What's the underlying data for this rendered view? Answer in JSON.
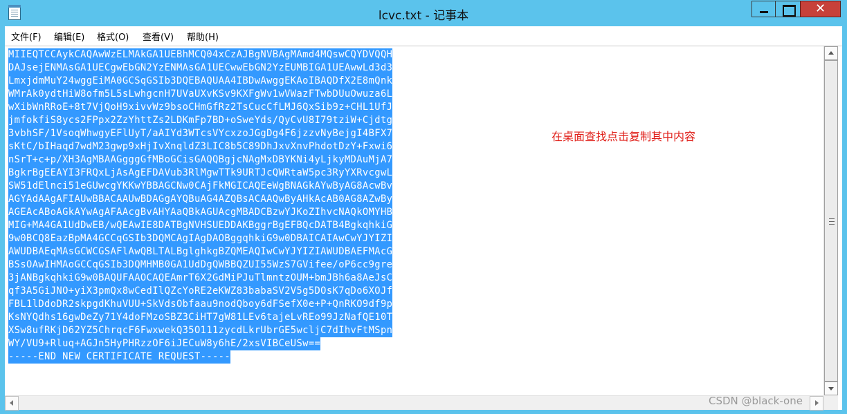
{
  "window": {
    "title": "lcvc.txt - 记事本",
    "close_glyph": "✕",
    "icons": {
      "app": "notepad-icon",
      "minimize": "minimize-icon",
      "maximize": "maximize-icon",
      "close": "close-icon"
    },
    "colors": {
      "titlebar": "#5bc3ec",
      "close_button": "#c7413a",
      "selection": "#3399ff",
      "annotation": "#e0201a"
    }
  },
  "menu": {
    "items": [
      {
        "label": "文件(F)"
      },
      {
        "label": "编辑(E)"
      },
      {
        "label": "格式(O)"
      },
      {
        "label": "查看(V)"
      },
      {
        "label": "帮助(H)"
      }
    ]
  },
  "editor": {
    "selected": true,
    "lines": [
      "MIIEQTCCAykCAQAwWzELMAkGA1UEBhMCQ04xCzAJBgNVBAgMAmd4MQswCQYDVQQH",
      "DAJsejENMAsGA1UECgwEbGN2YzENMAsGA1UECwwEbGN2YzEUMBIGA1UEAwwLd3d3",
      "LmxjdmMuY24wggEiMA0GCSqGSIb3DQEBAQUAA4IBDwAwggEKAoIBAQDfX2E8mQnk",
      "WMrAk0ydtHiW8ofm5L5sLwhgcnH7UVaUXvKSv9KXFgWv1wVWazFTwbDUuOwuza6L",
      "wXibWnRRoE+8t7VjQoH9xivvWz9bsoCHmGfRz2TsCucCfLMJ6QxSib9z+CHL1UfJ",
      "jmfokfiS8ycs2FPpx2ZzYhttZs2LDKmFp7BD+oSweYds/QyCvU8I79tziW+Cjdtg",
      "3vbhSF/1VsoqWhwgyEFlUyT/aAIYd3WTcsVYcxzoJGgDg4F6jzzvNyBejgI4BFX7",
      "sKtC/bIHaqd7wdM23gwp9xHjIvXnqldZ3LIC8b5C89DhJxvXnvPhdotDzY+Fxwi6",
      "nSrT+c+p/XH3AgMBAAGgggGfMBoGCisGAQQBgjcNAgMxDBYKNi4yLjkyMDAuMjA7",
      "BgkrBgEEAYI3FRQxLjAsAgEFDAVub3RlMgwTTk9URTJcQWRtaW5pc3RyYXRvcgwL",
      "SW51dElnci51eGUwcgYKKwYBBAGCNw0CAjFkMGICAQEeWgBNAGkAYwByAG8AcwBv",
      "AGYAdAAgAFIAUwBBACAAUwBDAGgAYQBuAG4AZQBsACAAQwByAHkAcAB0AG8AZwBy",
      "AGEAcABoAGkAYwAgAFAAcgBvAHYAaQBkAGUAcgMBADCBzwYJKoZIhvcNAQkOMYHB",
      "MIG+MA4GA1UdDwEB/wQEAwIE8DATBgNVHSUEDDAKBggrBgEFBQcDATB4BgkqhkiG",
      "9w0BCQ8EazBpMA4GCCqGSIb3DQMCAgIAgDAOBggqhkiG9w0DBAICAIAwCwYJYIZI",
      "AWUDBAEqMAsGCWCGSAFlAwQBLTALBglghkgBZQMEAQIwCwYJYIZIAWUDBAEFMAcG",
      "BSsOAwIHMAoGCCqGSIb3DQMHMB0GA1UdDgQWBBQZUI55WzS7GVifee/oP6cc9gre",
      "3jANBgkqhkiG9w0BAQUFAAOCAQEAmrT6X2GdMiPJuTlmntzOUM+bmJBh6a8AeJsC",
      "qf3A5GiJNO+yiX3pmQx8wCedIlQZcYoRE2eKWZ83babaSV2V5g5DOsK7qDo6XOJf",
      "FBL1lDdoDR2skpgdKhuVUU+SkVdsObfaau9nodQboy6dFSefX0e+P+QnRKO9df9p",
      "KsNYQdhs16gwDeZy71Y4doFMzoSBZ3CiHT7gW81LEv6tajeLvREo99JzNafQE10T",
      "XSw8ufRKjD62YZ5ChrqcF6FwxwekQ35O111zycdLkrUbrGE5wcljC7dIhvFtMSpn",
      "WY/VU9+Rluq+AGJn5HyPHRzzOF6iJECuW8y6hE/2xsVIBCeUSw==",
      "-----END NEW CERTIFICATE REQUEST-----"
    ]
  },
  "annotation": "在桌面查找点击复制其中内容",
  "watermark": "CSDN @black-one",
  "scrollbars": {
    "vertical_icons": {
      "up": "scroll-up-icon",
      "down": "scroll-down-icon"
    },
    "horizontal_icons": {
      "left": "scroll-left-icon",
      "right": "scroll-right-icon"
    }
  }
}
